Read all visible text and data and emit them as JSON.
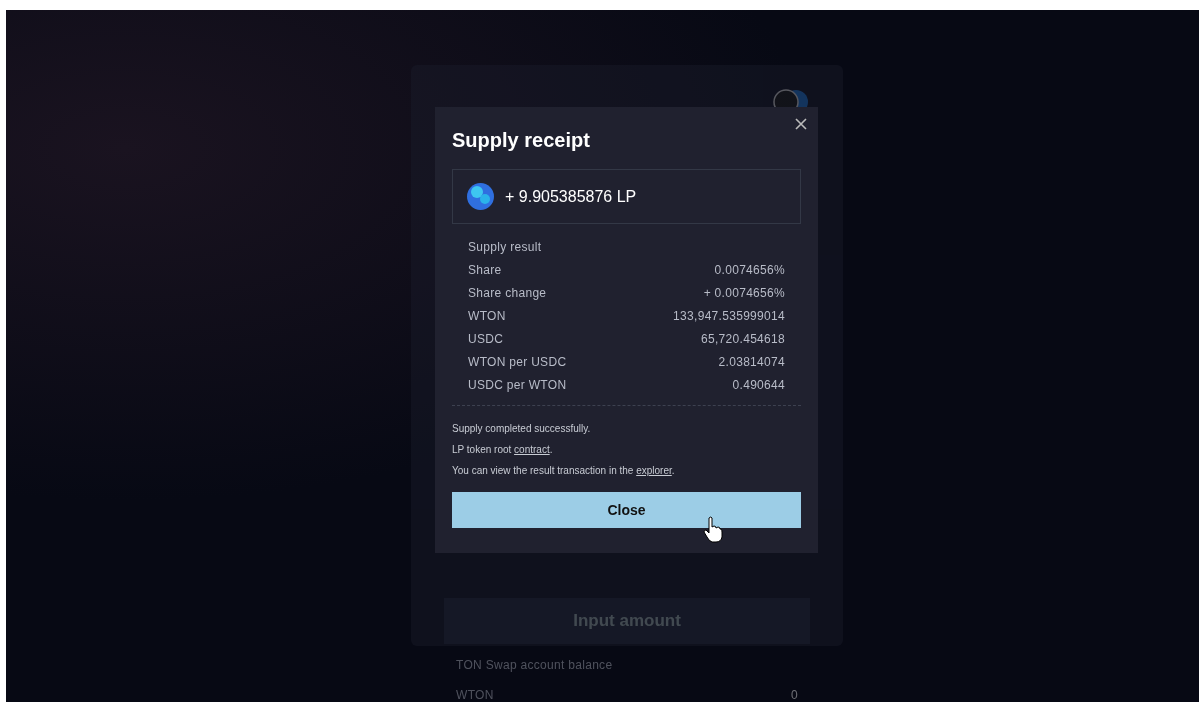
{
  "background_page": {
    "submit_button": "Input amount",
    "balance": {
      "title": "TON Swap account balance",
      "rows": [
        {
          "label": "WTON",
          "value": "0"
        }
      ]
    }
  },
  "modal": {
    "title": "Supply receipt",
    "lp_amount": "+ 9.905385876 LP",
    "result_title": "Supply result",
    "rows": [
      {
        "label": "Share",
        "value": "0.0074656%"
      },
      {
        "label": "Share change",
        "value": "+ 0.0074656%"
      },
      {
        "label": "WTON",
        "value": "133,947.535999014"
      },
      {
        "label": "USDC",
        "value": "65,720.454618"
      },
      {
        "label": "WTON per USDC",
        "value": "2.03814074"
      },
      {
        "label": "USDC per WTON",
        "value": "0.490644"
      }
    ],
    "messages": [
      {
        "text": "Supply completed successfully."
      },
      {
        "text": "LP token root ",
        "link": "contract",
        "after": "."
      },
      {
        "text": "You can view the result transaction in the ",
        "link": "explorer",
        "after": "."
      }
    ],
    "close_button": "Close"
  }
}
